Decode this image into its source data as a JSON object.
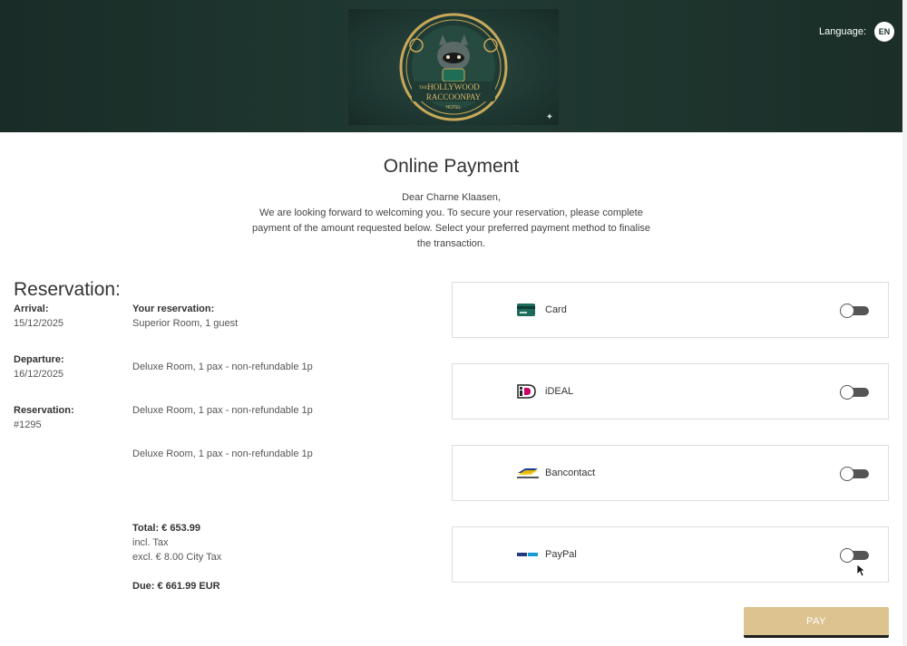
{
  "header": {
    "logo_alt": "The Hollywood Raccoonpay Hotel",
    "logo_line1": "THE",
    "logo_line2": "HOLLYWOOD",
    "logo_line3": "RACCOONPAY",
    "logo_line4": "HOTEL",
    "language_label": "Language:",
    "language_code": "EN"
  },
  "page": {
    "title": "Online Payment",
    "greeting": "Dear Charne Klaasen,",
    "intro_line1": "We are looking forward to welcoming you. To secure your reservation, please complete",
    "intro_line2": "payment of the amount requested below. Select your preferred payment method to finalise",
    "intro_line3": "the transaction."
  },
  "reservation": {
    "heading": "Reservation:",
    "arrival_label": "Arrival:",
    "arrival_value": "15/12/2025",
    "departure_label": "Departure:",
    "departure_value": "16/12/2025",
    "number_label": "Reservation:",
    "number_value": "#1295",
    "your_reservation_label": "Your reservation:",
    "rooms": [
      "Superior Room, 1 guest",
      "Deluxe Room, 1 pax - non-refundable 1p",
      "Deluxe Room, 1 pax - non-refundable 1p",
      "Deluxe Room, 1 pax - non-refundable 1p"
    ],
    "total": "Total: € 653.99",
    "incl_tax": "incl. Tax",
    "excl_tax": "excl. € 8.00 City Tax",
    "due": "Due: € 661.99 EUR"
  },
  "payment_methods": [
    {
      "label": "Card",
      "icon": "credit-card-icon",
      "enabled": false
    },
    {
      "label": "iDEAL",
      "icon": "ideal-logo-icon",
      "enabled": false
    },
    {
      "label": "Bancontact",
      "icon": "bancontact-logo-icon",
      "enabled": false
    },
    {
      "label": "PayPal",
      "icon": "paypal-logo-icon",
      "enabled": false
    }
  ],
  "pay_button": "PAY",
  "colors": {
    "header_bg": "#1c302a",
    "pay_button": "#dcc38f",
    "card_icon": "#1e6b5c"
  }
}
